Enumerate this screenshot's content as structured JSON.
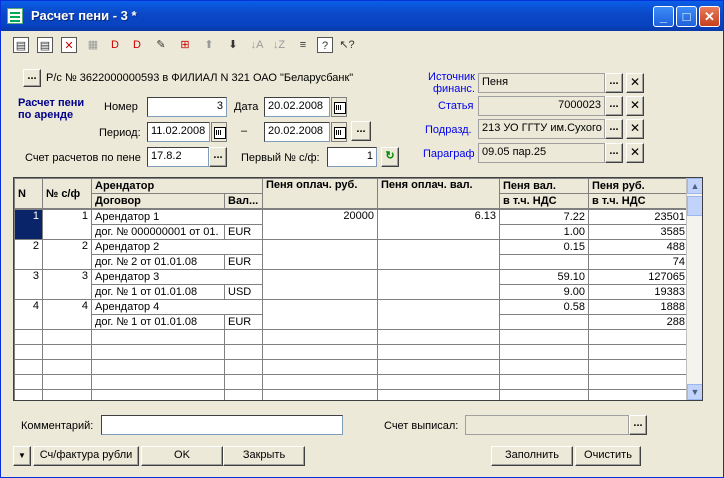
{
  "window": {
    "title": "Расчет пени - 3 *"
  },
  "header": {
    "account_text": "Р/с № 3622000000593 в ФИЛИАЛ N 321 ОАО \"Беларусбанк\"",
    "form_title": "Расчет пени по аренде",
    "number_label": "Номер",
    "number_value": "3",
    "date_label": "Дата",
    "date_value": "20.02.2008",
    "period_label": "Период:",
    "period_from": "11.02.2008",
    "period_dash": "–",
    "period_to": "20.02.2008",
    "account_label": "Счет расчетов по пене",
    "account_value": "17.8.2",
    "first_invoice_label": "Первый № с/ф:",
    "first_invoice_value": "1"
  },
  "right_panel": {
    "source_label": "Источник финанс.",
    "source_value": "Пеня",
    "article_label": "Статья",
    "article_value": "7000023",
    "division_label": "Подразд.",
    "division_value": "213 УО ГГТУ им.Сухого",
    "paragraph_label": "Параграф",
    "paragraph_value": "09.05 пар.25"
  },
  "table": {
    "headers": {
      "n": "N",
      "sf": "№ с/ф",
      "tenant": "Арендатор",
      "contract": "Договор",
      "currency": "Вал...",
      "paid_rub": "Пеня оплач. руб.",
      "paid_cur": "Пеня оплач. вал.",
      "penalty_cur": "Пеня вал.",
      "penalty_cur_vat": "в т.ч. НДС",
      "penalty_rub": "Пеня руб.",
      "penalty_rub_vat": "в т.ч. НДС"
    },
    "rows": [
      {
        "n": "1",
        "sf": "1",
        "tenant": "Арендатор 1",
        "contract": "дог. № 000000001 от 01.",
        "currency": "EUR",
        "paid_rub": "20000",
        "paid_cur": "6.13",
        "penalty_cur": "7.22",
        "penalty_cur_vat": "1.00",
        "penalty_rub": "23501",
        "penalty_rub_vat": "3585"
      },
      {
        "n": "2",
        "sf": "2",
        "tenant": "Арендатор 2",
        "contract": "дог. № 2 от 01.01.08",
        "currency": "EUR",
        "paid_rub": "",
        "paid_cur": "",
        "penalty_cur": "0.15",
        "penalty_cur_vat": "",
        "penalty_rub": "488",
        "penalty_rub_vat": "74"
      },
      {
        "n": "3",
        "sf": "3",
        "tenant": "Арендатор 3",
        "contract": "дог. № 1 от 01.01.08",
        "currency": "USD",
        "paid_rub": "",
        "paid_cur": "",
        "penalty_cur": "59.10",
        "penalty_cur_vat": "9.00",
        "penalty_rub": "127065",
        "penalty_rub_vat": "19383"
      },
      {
        "n": "4",
        "sf": "4",
        "tenant": "Арендатор 4",
        "contract": "дог. № 1 от 01.01.08",
        "currency": "EUR",
        "paid_rub": "",
        "paid_cur": "",
        "penalty_cur": "0.58",
        "penalty_cur_vat": "",
        "penalty_rub": "1888",
        "penalty_rub_vat": "288"
      }
    ]
  },
  "footer": {
    "comment_label": "Комментарий:",
    "comment_value": "",
    "issuer_label": "Счет выписал:",
    "issuer_value": "",
    "invoice_button": "Сч/фактура рубли",
    "ok_button": "OK",
    "close_button": "Закрыть",
    "fill_button": "Заполнить",
    "clear_button": "Очистить"
  }
}
